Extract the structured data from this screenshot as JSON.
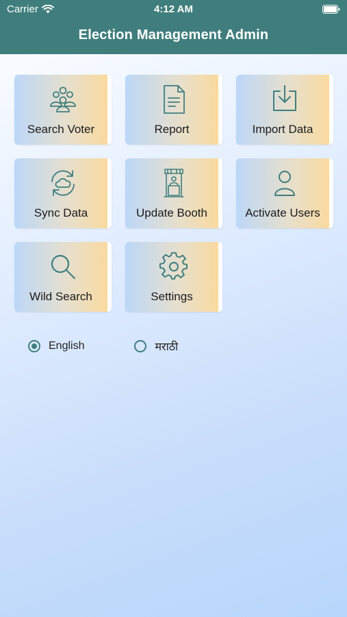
{
  "status_bar": {
    "carrier": "Carrier",
    "time": "4:12 AM"
  },
  "header": {
    "title": "Election Management Admin"
  },
  "tiles": [
    {
      "label": "Search Voter",
      "icon": "people-group-icon"
    },
    {
      "label": "Report",
      "icon": "document-icon"
    },
    {
      "label": "Import Data",
      "icon": "download-icon"
    },
    {
      "label": "Sync Data",
      "icon": "cloud-sync-icon"
    },
    {
      "label": "Update Booth",
      "icon": "booth-icon"
    },
    {
      "label": "Activate Users",
      "icon": "user-icon"
    },
    {
      "label": "Wild Search",
      "icon": "search-icon"
    },
    {
      "label": "Settings",
      "icon": "gear-icon"
    }
  ],
  "language": {
    "options": [
      {
        "label": "English",
        "selected": true
      },
      {
        "label": "मराठी",
        "selected": false
      }
    ]
  },
  "colors": {
    "header": "#3f7e7d",
    "icon": "#3f7e7d",
    "tile_left": "#bdd7f8",
    "tile_right": "#fbd99a"
  }
}
